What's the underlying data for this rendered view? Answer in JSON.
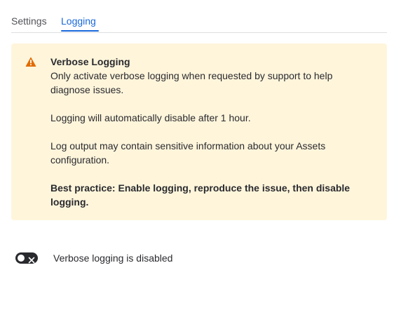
{
  "tabs": [
    {
      "label": "Settings",
      "active": false
    },
    {
      "label": "Logging",
      "active": true
    }
  ],
  "panel": {
    "icon": "warning-icon",
    "background": "#fff5db",
    "icon_color": "#e06c00",
    "title": "Verbose Logging",
    "paragraphs": [
      "Only activate verbose logging when requested by support to help diagnose issues.",
      "Logging will automatically disable after 1 hour.",
      "Log output may contain sensitive information about your Assets configuration."
    ],
    "best_practice": "Best practice: Enable logging, reproduce the issue, then disable logging."
  },
  "toggle": {
    "state": "off",
    "label": "Verbose logging is disabled"
  },
  "colors": {
    "accent": "#1868db",
    "text": "#292a2e",
    "subtle_text": "#505258"
  }
}
